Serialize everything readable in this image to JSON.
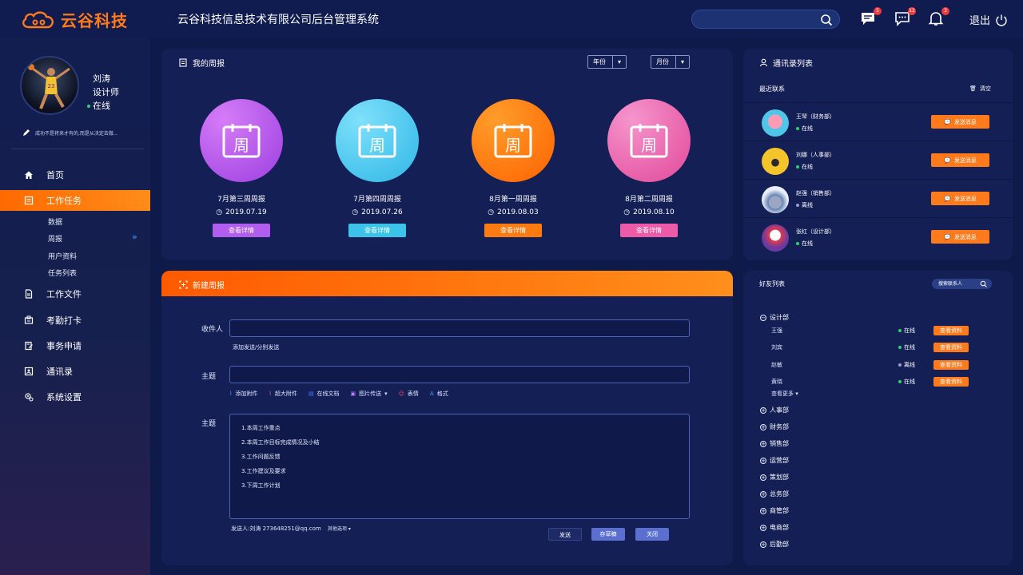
{
  "app": {
    "logo_text": "云谷科技",
    "system_title": "云谷科技信息技术有限公司后台管理系统",
    "logout_label": "退出",
    "badges": {
      "messages": "5",
      "chat": "12",
      "notifications": "3"
    }
  },
  "user": {
    "name": "刘涛",
    "role": "设计师",
    "status": "在线",
    "motto": "成功不是将来才有的,而是从决定去做..."
  },
  "sidebar": {
    "items": [
      {
        "label": "首页",
        "icon": "home-icon"
      },
      {
        "label": "工作任务",
        "icon": "task-icon"
      },
      {
        "label": "工作文件",
        "icon": "file-icon"
      },
      {
        "label": "考勤打卡",
        "icon": "punch-icon"
      },
      {
        "label": "事务申请",
        "icon": "apply-icon"
      },
      {
        "label": "通讯录",
        "icon": "contacts-icon"
      },
      {
        "label": "系统设置",
        "icon": "settings-icon"
      }
    ],
    "subitems": [
      "数据",
      "周报",
      "用户资料",
      "任务列表"
    ]
  },
  "my_reports": {
    "title": "我的周报",
    "year_select": "年份",
    "month_select": "月份",
    "glyph": "周",
    "detail_label": "查看详情",
    "items": [
      {
        "title": "7月第三周周报",
        "date": "2019.07.19"
      },
      {
        "title": "7月第四周周报",
        "date": "2019.07.26"
      },
      {
        "title": "8月第一周周报",
        "date": "2019.08.03"
      },
      {
        "title": "8月第二周周报",
        "date": "2019.08.10"
      }
    ]
  },
  "new_report": {
    "title": "新建周报",
    "recipient_label": "收件人",
    "add_send_link": "添加发送/分别发送",
    "subject_label": "主题",
    "body_label": "主题",
    "tools": [
      "添加附件",
      "超大附件",
      "在线文档",
      "图片传送",
      "表情",
      "格式"
    ],
    "body_lines": [
      "1.本周工作重点",
      "2.本周工作目标完成情况及小结",
      "3.工作问题反馈",
      "3.工作建议及要求",
      "3.下周工作计划"
    ],
    "sender": "发送人:刘涛 273648251@qq.com",
    "other_options": "其他选项",
    "send_btn": "发送",
    "draft_btn": "存草稿",
    "close_btn": "关闭"
  },
  "contacts": {
    "title": "通讯录列表",
    "recent_label": "最近联系",
    "clear_label": "清空",
    "send_label": "发送消息",
    "items": [
      {
        "name": "王琴（财务部）",
        "status": "在线"
      },
      {
        "name": "刘娜（人事部）",
        "status": "在线"
      },
      {
        "name": "赵强（销售部）",
        "status": "离线"
      },
      {
        "name": "张红（设计部）",
        "status": "在线"
      }
    ]
  },
  "friends": {
    "title": "好友列表",
    "search_placeholder": "搜索联系人",
    "open_group": "设计部",
    "members": [
      {
        "name": "王强",
        "status": "在线"
      },
      {
        "name": "刘宾",
        "status": "在线"
      },
      {
        "name": "赵敏",
        "status": "离线"
      },
      {
        "name": "黄晓",
        "status": "在线"
      }
    ],
    "view_label": "查看资料",
    "more_label": "查看更多",
    "groups": [
      "人事部",
      "财务部",
      "销售部",
      "运营部",
      "策划部",
      "总务部",
      "商管部",
      "电商部",
      "后勤部"
    ]
  },
  "colors": {
    "accent": "#ff7a1a",
    "online": "#2bd46b",
    "offline": "#9aa3c4",
    "report_purple": "#a64fe6",
    "report_cyan": "#3cc3ea",
    "report_orange": "#ff7a10",
    "report_pink": "#ec5aa8"
  }
}
